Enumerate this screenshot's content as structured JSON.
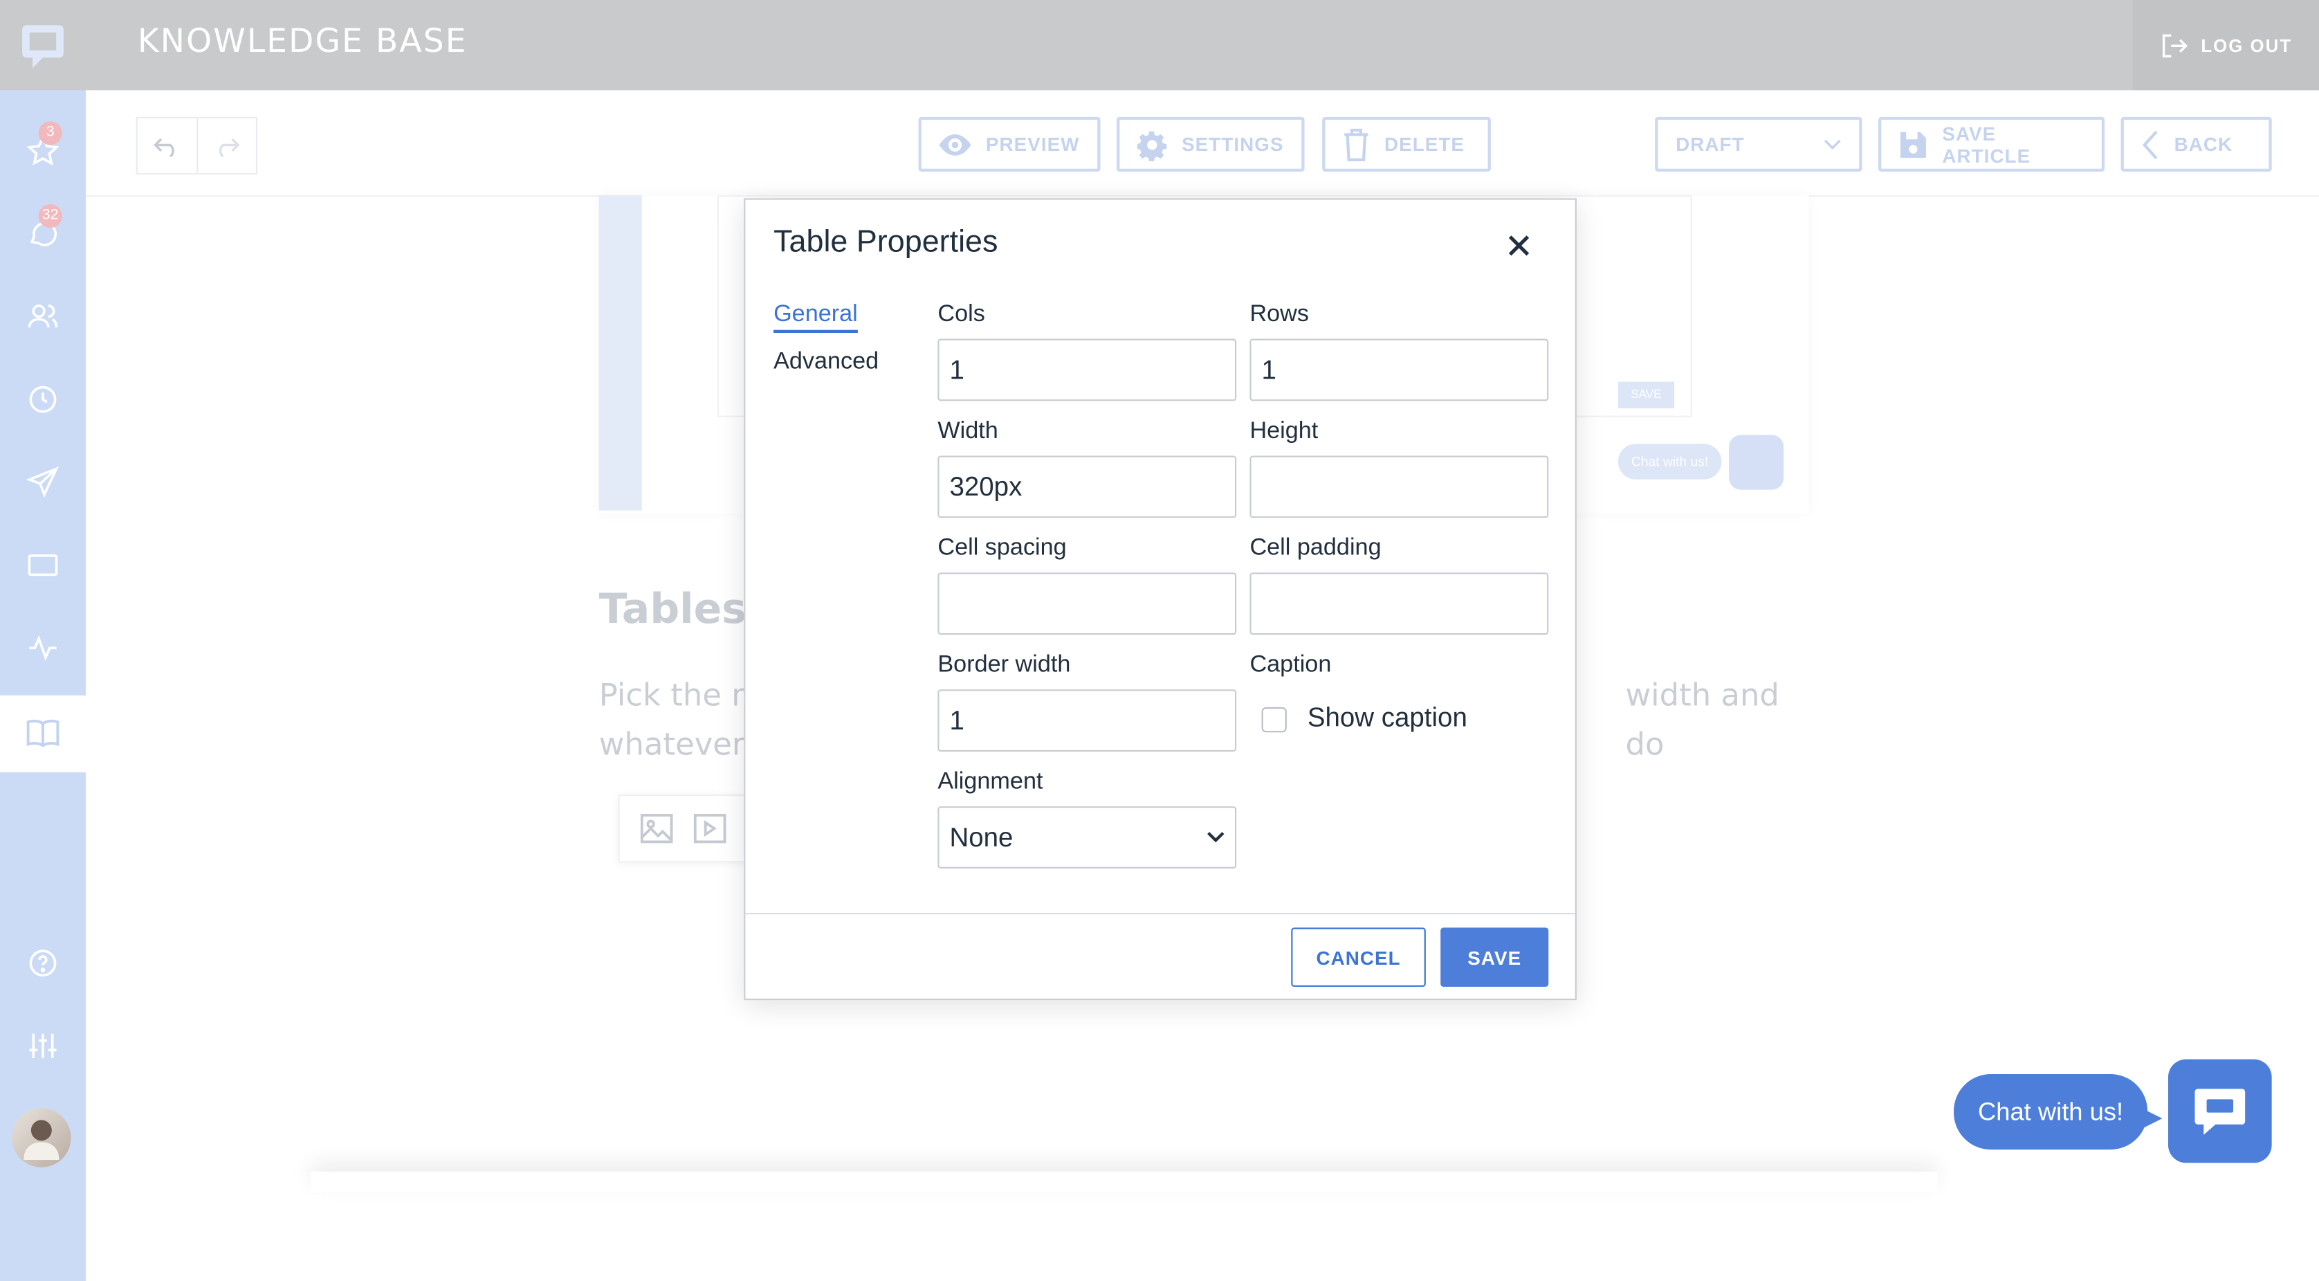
{
  "app": {
    "title": "KNOWLEDGE BASE",
    "logout_label": "LOG OUT"
  },
  "sidebar": {
    "items": [
      {
        "icon": "star-icon",
        "badge": "3"
      },
      {
        "icon": "chat-icon",
        "badge": "32"
      },
      {
        "icon": "users-icon"
      },
      {
        "icon": "clock-icon"
      },
      {
        "icon": "send-icon"
      },
      {
        "icon": "window-icon"
      },
      {
        "icon": "activity-icon"
      },
      {
        "icon": "book-icon",
        "active": true
      },
      {
        "icon": "help-icon"
      },
      {
        "icon": "sliders-icon"
      }
    ]
  },
  "toolbar": {
    "preview_label": "PREVIEW",
    "settings_label": "SETTINGS",
    "delete_label": "DELETE",
    "status_value": "DRAFT",
    "save_article_label": "SAVE ARTICLE",
    "back_label": "BACK"
  },
  "content": {
    "heading": "Tables",
    "paragraph_start": "Pick the n",
    "paragraph_end": "width and do",
    "paragraph_line2": "whatever",
    "preview_chat_label": "Chat with us!",
    "preview_save_label": "SAVE"
  },
  "dialog": {
    "title": "Table Properties",
    "tabs": [
      "General",
      "Advanced"
    ],
    "fields": {
      "cols": {
        "label": "Cols",
        "value": "1"
      },
      "rows": {
        "label": "Rows",
        "value": "1"
      },
      "width": {
        "label": "Width",
        "value": "320px"
      },
      "height": {
        "label": "Height",
        "value": ""
      },
      "cell_spacing": {
        "label": "Cell spacing",
        "value": ""
      },
      "cell_padding": {
        "label": "Cell padding",
        "value": ""
      },
      "border_width": {
        "label": "Border width",
        "value": "1"
      },
      "caption": {
        "label": "Caption",
        "checkbox_label": "Show caption",
        "checked": false
      },
      "alignment": {
        "label": "Alignment",
        "value": "None"
      }
    },
    "cancel_label": "CANCEL",
    "save_label": "SAVE"
  },
  "chat_widget": {
    "label": "Chat with us!"
  },
  "colors": {
    "accent": "#4d7fda",
    "sidebar": "#ccdbf5",
    "topbar": "#c9cacc"
  }
}
